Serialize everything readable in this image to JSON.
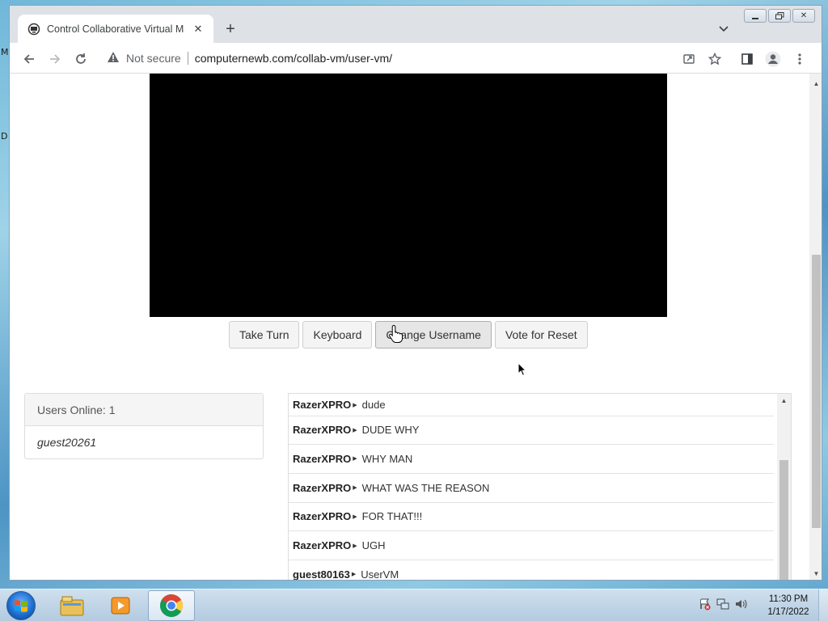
{
  "desktop": {
    "edge_glyphs": [
      "M",
      "D"
    ]
  },
  "browser": {
    "tab": {
      "title": "Control Collaborative Virtual Machine",
      "favicon": "collabvm-icon"
    },
    "omnibox": {
      "security_label": "Not secure",
      "url": "computernewb.com/collab-vm/user-vm/"
    },
    "window_controls": [
      "minimize",
      "restore",
      "close"
    ]
  },
  "page": {
    "vm_buttons": [
      {
        "label": "Take Turn"
      },
      {
        "label": "Keyboard"
      },
      {
        "label": "Change Username"
      },
      {
        "label": "Vote for Reset"
      }
    ],
    "users": {
      "header": "Users Online: 1",
      "list": [
        "guest20261"
      ]
    },
    "chat": {
      "messages": [
        {
          "user": "RazerXPRO",
          "text": "dude"
        },
        {
          "user": "RazerXPRO",
          "text": "DUDE WHY"
        },
        {
          "user": "RazerXPRO",
          "text": "WHY MAN"
        },
        {
          "user": "RazerXPRO",
          "text": "WHAT WAS THE REASON"
        },
        {
          "user": "RazerXPRO",
          "text": "FOR THAT!!!"
        },
        {
          "user": "RazerXPRO",
          "text": "UGH"
        },
        {
          "user": "guest80163",
          "text": "UserVM"
        }
      ]
    }
  },
  "taskbar": {
    "apps": [
      "explorer-icon",
      "media-player-icon",
      "chrome-icon"
    ],
    "tray": [
      "action-center-icon",
      "network-icon",
      "volume-icon"
    ],
    "clock": {
      "time": "11:30 PM",
      "date": "1/17/2022"
    }
  }
}
